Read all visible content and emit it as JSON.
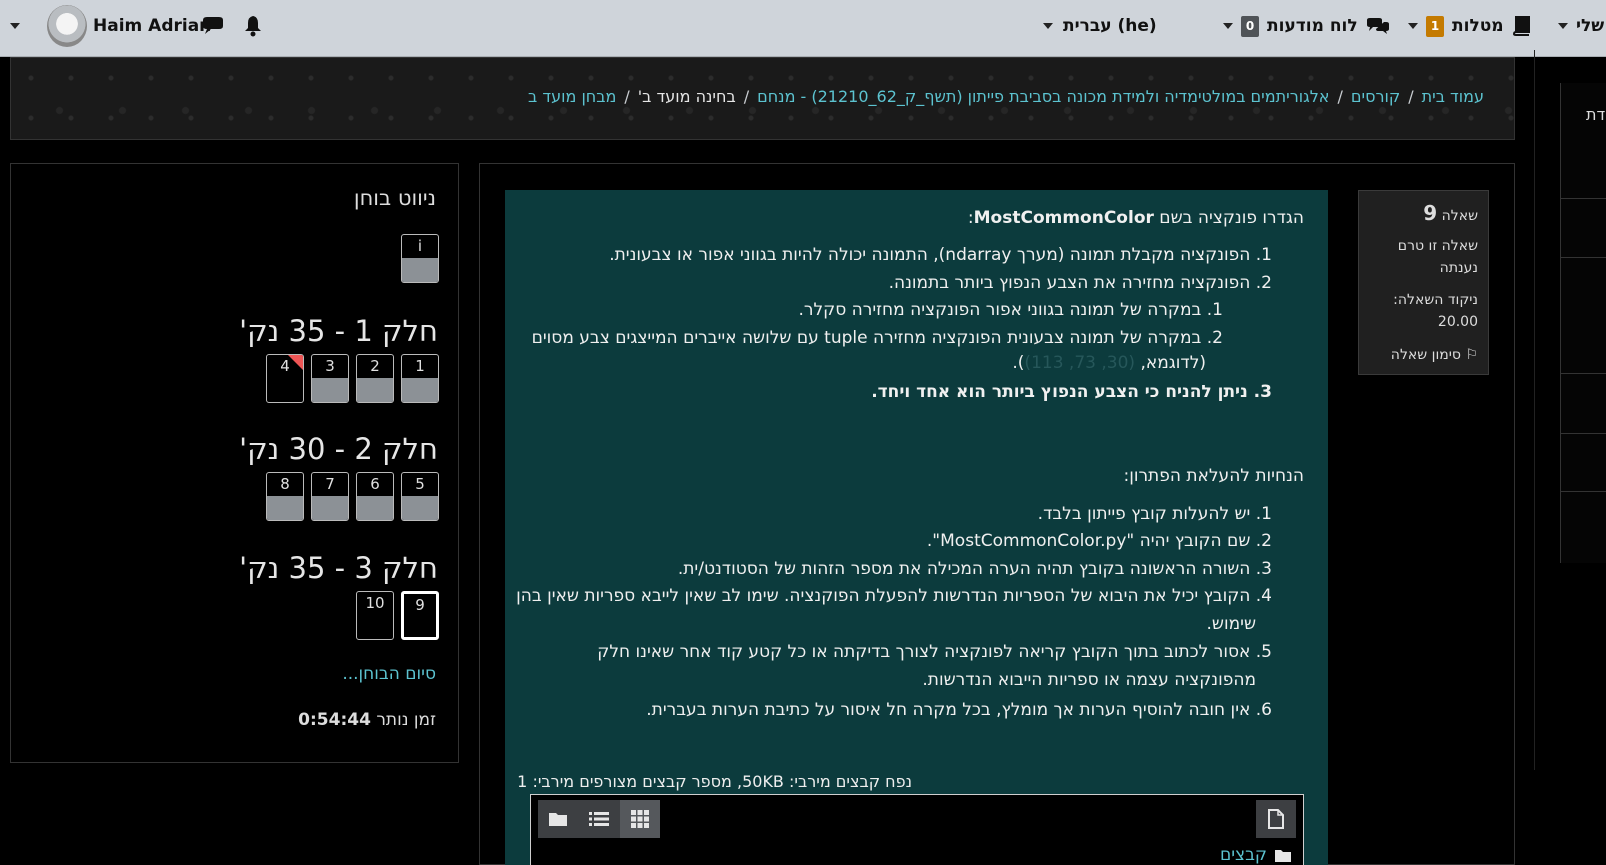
{
  "navbar": {
    "user_name": "Haim Adrian",
    "language": "עברית (he)",
    "notifications_label": "לוח מודעות",
    "notifications_count": "0",
    "tasks_label": "מטלות",
    "tasks_count": "1",
    "edge_label": "שלי"
  },
  "breadcrumb": {
    "home": "עמוד בית",
    "courses": "קורסים",
    "course": "אלגוריתמים במולטימדיה ולמידת מכונה בסביבת פייתון (תשף_ק_62_21210) - מנחם",
    "section": "בחינה מועד ב'",
    "quiz": "מבחן מועד ב"
  },
  "right_edge_label": "דת",
  "quiz_nav": {
    "title": "ניווט בוחן",
    "info_button": "i",
    "sections": [
      {
        "title": "חלק 1 - 35 נק'",
        "buttons": [
          "1",
          "2",
          "3",
          "4"
        ]
      },
      {
        "title": "חלק 2 - 30 נק'",
        "buttons": [
          "5",
          "6",
          "7",
          "8"
        ]
      },
      {
        "title": "חלק 3 - 35 נק'",
        "buttons": [
          "9",
          "10"
        ]
      }
    ],
    "finish_link": "סיום הבוחן...",
    "time_label": "זמן נותר",
    "time_value": "0:54:44"
  },
  "question_info": {
    "label": "שאלה",
    "number": "9",
    "status": "שאלה זו טרם נענתה",
    "marks_label": "ניקוד השאלה:",
    "marks_value": "20.00",
    "flag_label": "סימון שאלה"
  },
  "question": {
    "intro_prefix": "הגדרו פונקציה בשם",
    "function_name": "MostCommonColor",
    "intro_suffix": ":",
    "items": [
      "1. הפונקציה מקבלת תמונה (מערך ndarray), התמונה יכולה להיות בגווני אפור או צבעונית.",
      "2. הפונקציה מחזירה את הצבע הנפוץ ביותר בתמונה."
    ],
    "subitems": [
      "1. במקרה של תמונה בגווני אפור הפונקציה מחזירה סקלר.",
      "2. במקרה של תמונה צבעונית הפונקציה מחזירה tuple עם שלושה אייברים המייצגים צבע מסוים"
    ],
    "example_prefix": "(לדוגמא, ",
    "example_value": "(30, 73, 113)",
    "example_suffix": ").",
    "item3": "3. ניתן להניח כי הצבע הנפוץ ביותר הוא אחד ויחד.",
    "upload_heading": "הנחיות להעלאת הפתרון:",
    "upload_items": [
      "1. יש להעלות קובץ פייתון בלבד.",
      "2. שם הקובץ יהיה \"MostCommonColor.py\".",
      "3. השורה הראשונה בקובץ תהיה הערה המכילה את מספר הזהות של הסטודנט/ית.",
      "4. הקובץ יכיל את היבוא של הספריות הנדרשות להפעלת הפוקנציה. שימו לב שאין לייבא ספריות שאין בהן",
      "שימוש.",
      "5. אסור לכתוב בתוך הקובץ קריאה לפונקציה לצורך בדיקתה או כל קטע קוד אחר שאינו חלק",
      "מהפונקציה עצמה או ספריות הייבוא הנדרשות.",
      "6. אין חובה להוסיף הערות אך מומלץ, בכל מקרה חל איסור על כתיבת הערות בעברית."
    ],
    "upload_meta": "נפח קבצים מירבי: 50KB, מספר קבצים מצורפים מירבי: 1",
    "files_label": "קבצים"
  }
}
